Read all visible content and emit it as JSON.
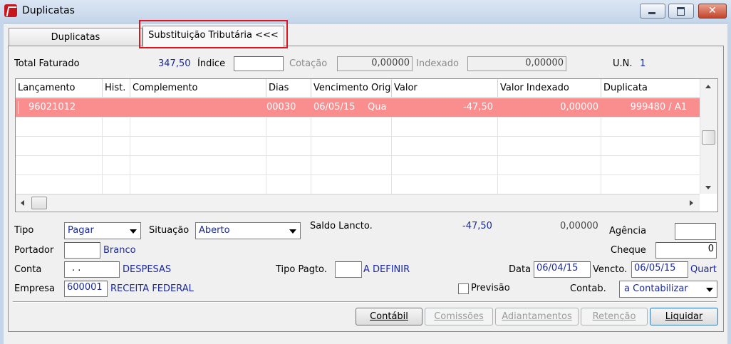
{
  "window": {
    "title": "Duplicatas"
  },
  "tabs": [
    {
      "label": "Duplicatas"
    },
    {
      "label": "Substituição Tributária <<<"
    }
  ],
  "summary": {
    "total_label": "Total Faturado",
    "total_value": "347,50",
    "indice_label": "Índice",
    "indice_value": "",
    "cotacao_label": "Cotação",
    "cotacao_value": "0,00000",
    "indexado_label": "Indexado",
    "indexado_value": "0,00000",
    "un_label": "U.N.",
    "un_value": "1"
  },
  "grid": {
    "columns": [
      "Lançamento",
      "Hist.",
      "Complemento",
      "Dias",
      "Vencimento Orig.",
      "Valor",
      "Valor Indexado",
      "Duplicata"
    ],
    "rows": [
      {
        "lancamento": "96021012",
        "hist": "",
        "complemento": "",
        "dias": "00030",
        "vencimento": "06/05/15",
        "dia_semana": "Qua",
        "valor": "-47,50",
        "valor_indexado": "0,00000",
        "duplicata": "999480 / A1"
      }
    ]
  },
  "form": {
    "tipo_label": "Tipo",
    "tipo_value": "Pagar",
    "situacao_label": "Situação",
    "situacao_value": "Aberto",
    "saldo_label": "Saldo Lancto.",
    "saldo_value": "-47,50",
    "saldo_indexado": "0,00000",
    "agencia_label": "Agência",
    "agencia_value": "",
    "portador_label": "Portador",
    "portador_code": "",
    "portador_name": "Branco",
    "cheque_label": "Cheque",
    "cheque_value": "0",
    "conta_label": "Conta",
    "conta_code": ". .",
    "conta_name": "DESPESAS",
    "tipo_pagto_label": "Tipo Pagto.",
    "tipo_pagto_code": "",
    "tipo_pagto_name": "A DEFINIR",
    "data_label": "Data",
    "data_value": "06/04/15",
    "vencto_label": "Vencto.",
    "vencto_value": "06/05/15",
    "vencto_dia": "Quart",
    "empresa_label": "Empresa",
    "empresa_code": "600001",
    "empresa_name": "RECEITA FEDERAL",
    "previsao_label": "Previsão",
    "contab_label": "Contab.",
    "contab_value": "a Contabilizar"
  },
  "buttons": {
    "contabil": "Contábil",
    "comissoes": "Comissões",
    "adiantamentos": "Adiantamentos",
    "retencao": "Retenção",
    "liquidar": "Liquidar"
  },
  "colors": {
    "selected_row": "#fa8d8d",
    "value_text": "#1a2a9c",
    "highlight_border": "#e0141e"
  }
}
